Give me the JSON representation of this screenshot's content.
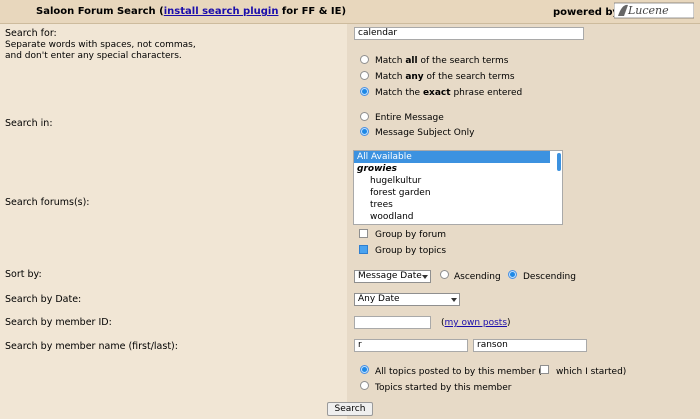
{
  "header": {
    "title_prefix": "Saloon Forum Search (",
    "title_link": "install search plugin",
    "title_suffix": " for FF & IE)",
    "powered_by": "powered by",
    "logo_text": "Lucene"
  },
  "search_for": {
    "label": "Search for:",
    "help_lines": [
      "Separate words with spaces, not commas,",
      "and don't enter any special characters."
    ],
    "value": "calendar",
    "match_options": [
      {
        "pre": "Match ",
        "bold": "all",
        "post": " of the search terms",
        "selected": false
      },
      {
        "pre": "Match ",
        "bold": "any",
        "post": " of the search terms",
        "selected": false
      },
      {
        "pre": "Match the ",
        "bold": "exact",
        "post": " phrase entered",
        "selected": true
      }
    ]
  },
  "search_in": {
    "label": "Search in:",
    "options": [
      {
        "label": "Entire Message",
        "selected": false
      },
      {
        "label": "Message Subject Only",
        "selected": true
      }
    ]
  },
  "search_forums": {
    "label": "Search forums(s):",
    "items": [
      {
        "label": "All Available",
        "type": "selected"
      },
      {
        "label": "growies",
        "type": "group"
      },
      {
        "label": "hugelkultur",
        "type": "sub"
      },
      {
        "label": "forest garden",
        "type": "sub"
      },
      {
        "label": "trees",
        "type": "sub"
      },
      {
        "label": "woodland",
        "type": "sub"
      }
    ],
    "group_by_forum": {
      "label": "Group by forum",
      "checked": false
    },
    "group_by_topics": {
      "label": "Group by topics",
      "checked": true
    }
  },
  "sort_by": {
    "label": "Sort by:",
    "value": "Message Date",
    "ascending": {
      "label": "Ascending",
      "selected": false
    },
    "descending": {
      "label": "Descending",
      "selected": true
    }
  },
  "search_by_date": {
    "label": "Search by Date:",
    "value": "Any Date"
  },
  "member_id": {
    "label": "Search by member ID:",
    "value": "",
    "link_open": "(",
    "link": "my own posts",
    "link_close": ")"
  },
  "member_name": {
    "label": "Search by member name (first/last):",
    "first": "r",
    "last": "ranson"
  },
  "topics": {
    "all_topics_pre": "All topics posted to by this member (",
    "all_topics_selected": true,
    "which_i_started": "which I started)",
    "which_checked": false,
    "started_by": "Topics started by this member",
    "started_selected": false
  },
  "submit_label": "Search"
}
